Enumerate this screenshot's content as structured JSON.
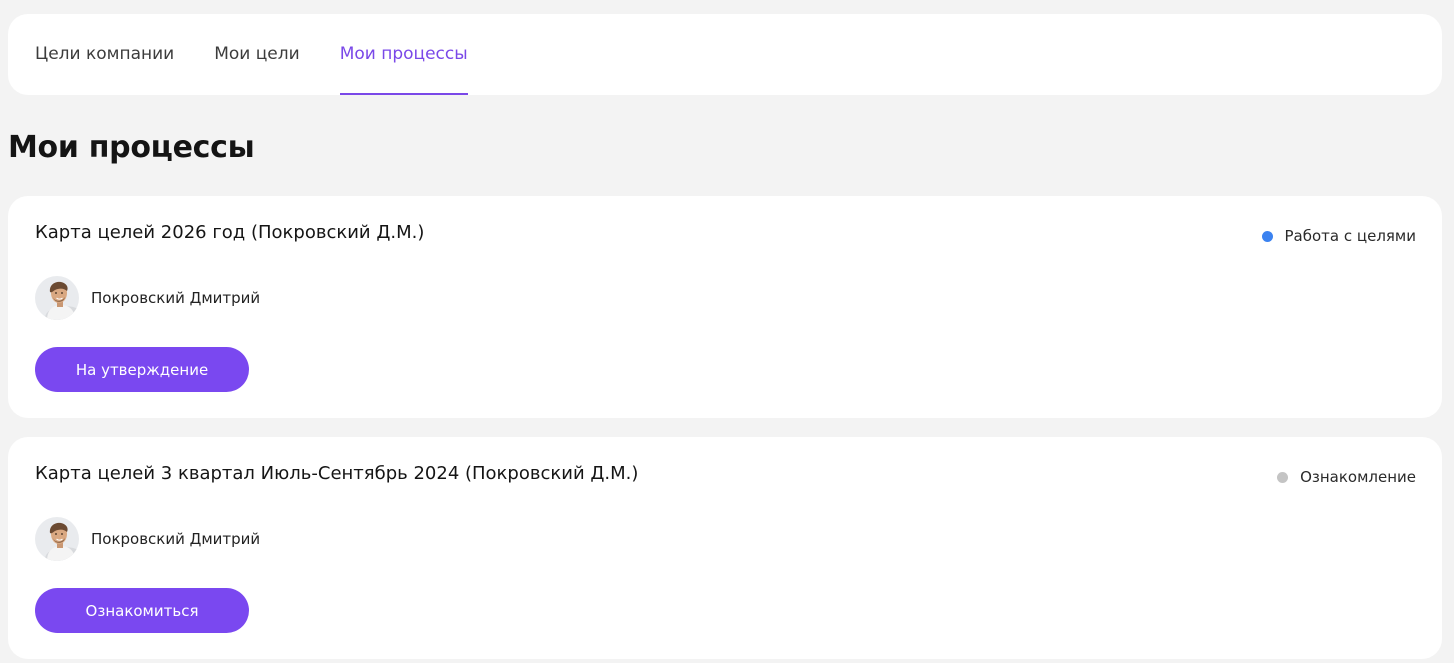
{
  "tabs": [
    {
      "label": "Цели компании",
      "active": false
    },
    {
      "label": "Мои цели",
      "active": false
    },
    {
      "label": "Мои процессы",
      "active": true
    }
  ],
  "page_title": "Мои процессы",
  "processes": [
    {
      "title": "Карта целей 2026 год (Покровский Д.М.)",
      "status": "Работа с целями",
      "status_color": "#3b82f0",
      "person_name": "Покровский Дмитрий",
      "action_label": "На утверждение"
    },
    {
      "title": "Карта целей 3 квартал Июль-Сентябрь 2024 (Покровский Д.М.)",
      "status": "Ознакомление",
      "status_color": "#c4c4c4",
      "person_name": "Покровский Дмитрий",
      "action_label": "Ознакомиться"
    }
  ],
  "colors": {
    "accent": "#7a48e8",
    "button": "#7a48f0",
    "background": "#f3f3f3",
    "card": "#ffffff"
  }
}
